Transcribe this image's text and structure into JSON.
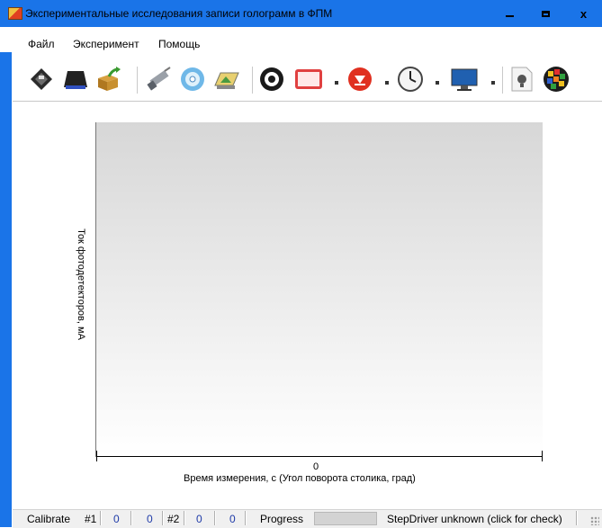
{
  "window": {
    "title": "Экспериментальные исследования записи голограмм в ФПМ"
  },
  "menu": {
    "items": [
      "Файл",
      "Эксперимент",
      "Помощь"
    ]
  },
  "toolbar": {
    "icons": [
      "floppy-disk-icon",
      "hard-drive-icon",
      "open-box-icon",
      "satellite-icon",
      "cd-disc-icon",
      "image-icon",
      "gear-icon",
      "frame-icon",
      "record-icon",
      "clock-icon",
      "monitor-icon",
      "bulb-icon",
      "mosaic-icon"
    ]
  },
  "chart_data": {
    "type": "line",
    "title": "",
    "xlabel": "Время измерения, с (Угол поворота столика, град)",
    "ylabel": "Ток фотодетекторов, мА",
    "x_ticks": [
      "0"
    ],
    "series": [],
    "grid": false
  },
  "status": {
    "calibrate": "Calibrate",
    "ch1_label": "#1",
    "ch1_val_a": "0",
    "ch1_val_b": "0",
    "ch2_label": "#2",
    "ch2_val_a": "0",
    "ch2_val_b": "0",
    "progress_label": "Progress",
    "progress_value": 0,
    "stepdriver": "StepDriver unknown (click for check)"
  },
  "colors": {
    "titlebar": "#1a74e8",
    "status_value": "#1e3aa8"
  }
}
